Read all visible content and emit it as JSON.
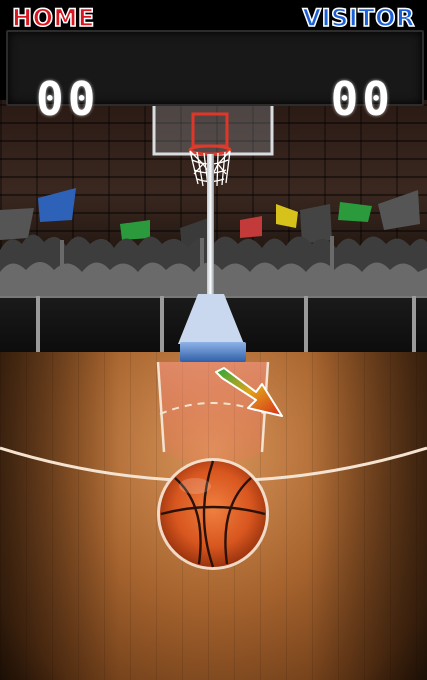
{
  "scoreboard": {
    "home_label": "HOME",
    "visitor_label": "VISITOR",
    "home_score": "00",
    "visitor_score": "00"
  },
  "colors": {
    "home": "#d61620",
    "visitor": "#1a5fd6",
    "court": "#b8743c",
    "ball": "#e0642a"
  },
  "icons": {
    "aim_arrow": "arrow-down-right-icon",
    "ball": "basketball-icon"
  }
}
